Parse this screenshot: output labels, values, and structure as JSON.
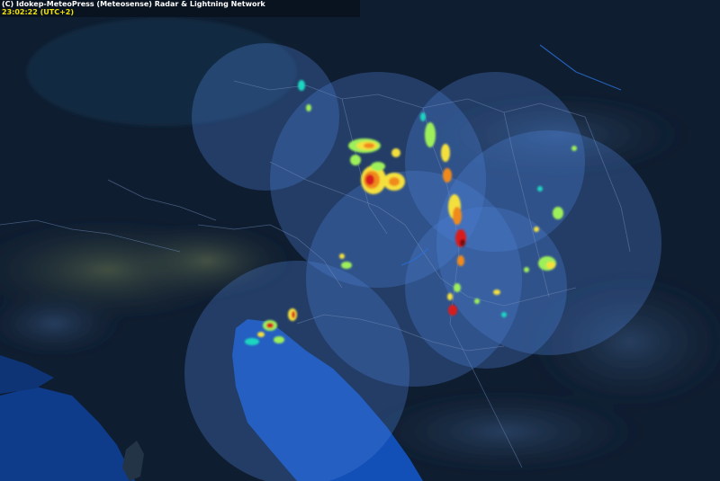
{
  "header": {
    "credit": "(C) Idokep-MeteoPress (Meteosense) Radar & Lightning Network",
    "timestamp": "23:02:22 (UTC+2)"
  },
  "colors": {
    "sea": "#0e3b8a",
    "land_dark": "#0c1a2c",
    "coverage": "#4d7fd6",
    "echo_weak": "#1fd6c0",
    "echo_light": "#9ef05a",
    "echo_moderate": "#f4e03c",
    "echo_strong": "#f08a1e",
    "echo_heavy": "#d81e1e",
    "echo_extreme": "#7a0a10"
  },
  "map": {
    "type": "radar-composite",
    "layers": [
      "terrain-relief",
      "country-borders",
      "radar-coverage",
      "precipitation-echoes"
    ]
  }
}
